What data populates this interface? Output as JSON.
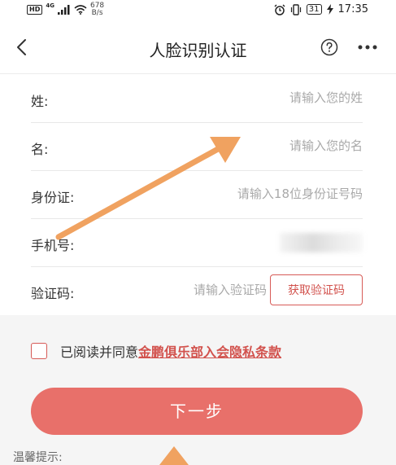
{
  "status_bar": {
    "hd_badge": "HD",
    "network_type": "4G",
    "speed_value": "678",
    "speed_unit": "B/s",
    "battery": "31",
    "time": "17:35"
  },
  "nav": {
    "title": "人脸识别认证",
    "back_icon": "chevron-left-icon",
    "help_icon": "question-circle-icon",
    "more_icon": "more-dots-icon"
  },
  "form": {
    "surname": {
      "label": "姓:",
      "placeholder": "请输入您的姓",
      "value": ""
    },
    "given_name": {
      "label": "名:",
      "placeholder": "请输入您的名",
      "value": ""
    },
    "id_number": {
      "label": "身份证:",
      "placeholder": "请输入18位身份证号码",
      "value": ""
    },
    "phone": {
      "label": "手机号:",
      "value": ""
    },
    "code": {
      "label": "验证码:",
      "placeholder": "请输入验证码",
      "value": ""
    },
    "get_code_label": "获取验证码"
  },
  "agreement": {
    "text": "已阅读并同意",
    "link": "金鹏俱乐部入会隐私条款",
    "checked": false
  },
  "next_button": "下一步",
  "tips_label": "温馨提示:",
  "colors": {
    "accent": "#d2524d",
    "button": "#e8706a",
    "annotation_arrow": "#f0a260"
  }
}
